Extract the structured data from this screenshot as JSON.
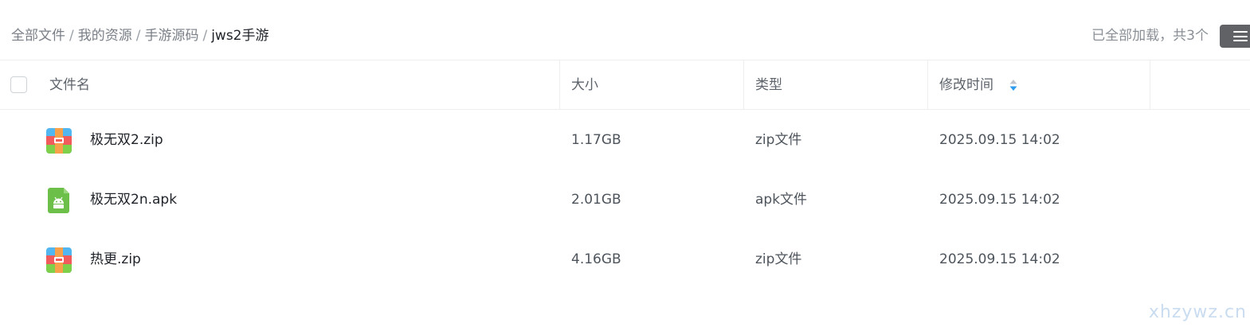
{
  "breadcrumb": {
    "items": [
      "全部文件",
      "我的资源",
      "手游源码"
    ],
    "current": "jws2手游",
    "separator": "/"
  },
  "status": {
    "load_text": "已全部加载，共3个"
  },
  "table": {
    "columns": {
      "name": "文件名",
      "size": "大小",
      "type": "类型",
      "modified": "修改时间"
    },
    "rows": [
      {
        "name": "极无双2.zip",
        "size": "1.17GB",
        "type": "zip文件",
        "modified": "2025.09.15 14:02",
        "icon": "zip-archive-icon"
      },
      {
        "name": "极无双2n.apk",
        "size": "2.01GB",
        "type": "apk文件",
        "modified": "2025.09.15 14:02",
        "icon": "android-apk-icon"
      },
      {
        "name": "热更.zip",
        "size": "4.16GB",
        "type": "zip文件",
        "modified": "2025.09.15 14:02",
        "icon": "zip-archive-icon"
      }
    ]
  },
  "watermark": "xhzywz.cn",
  "colors": {
    "menu_button": "#606266",
    "sort_active": "#2c9bf0",
    "apk_green": "#6cc04a",
    "watermark": "#c9dcf0"
  }
}
